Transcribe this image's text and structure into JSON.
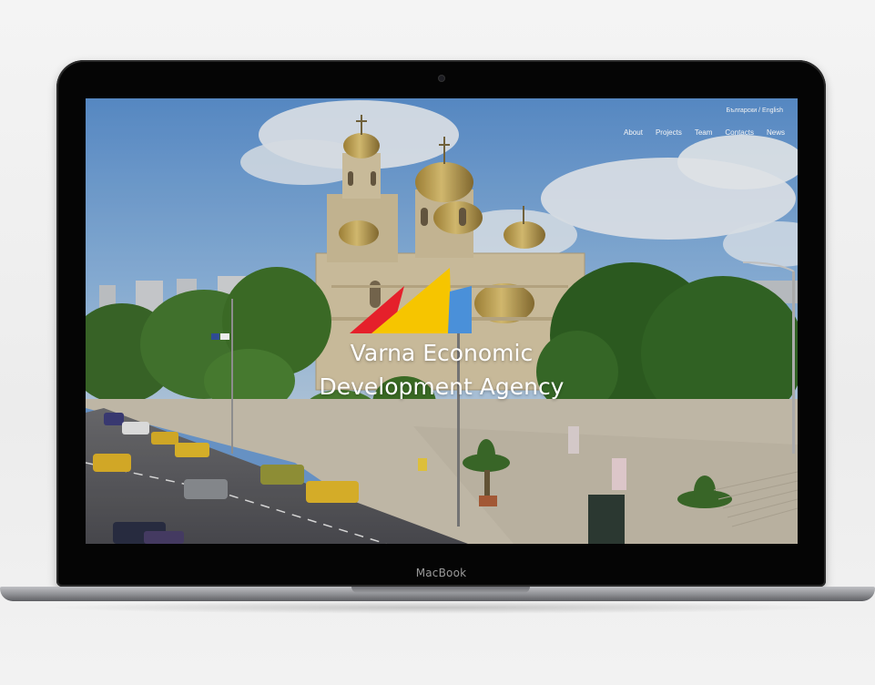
{
  "device": {
    "brand_label": "MacBook"
  },
  "site": {
    "lang_bg": "Български",
    "lang_sep": " / ",
    "lang_en": "English",
    "nav": [
      {
        "label": "About"
      },
      {
        "label": "Projects"
      },
      {
        "label": "Team"
      },
      {
        "label": "Contacts"
      },
      {
        "label": "News"
      }
    ],
    "title_line1": "Varna Economic",
    "title_line2": "Development Agency"
  },
  "colors": {
    "logo_red": "#e5202b",
    "logo_yellow": "#f6c500",
    "logo_blue": "#4a90d9"
  }
}
